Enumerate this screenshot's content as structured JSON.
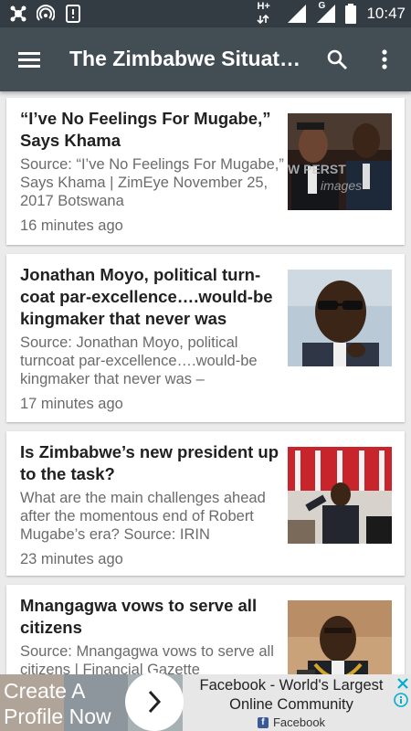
{
  "status_bar": {
    "time": "10:47",
    "network_label": "H+",
    "signal2_label": "G",
    "left_icons": [
      "bug-icon",
      "wifi-hotspot-icon",
      "phone-alert-icon"
    ],
    "right_icons": [
      "signal-icon",
      "battery-icon"
    ]
  },
  "app_bar": {
    "title": "The Zimbabwe Situat…",
    "icons": [
      "menu-icon",
      "search-icon",
      "more-vert-icon"
    ]
  },
  "articles": [
    {
      "title": "“I’ve No Feelings For Mugabe,” Says Khama",
      "description": "Source: “I’ve No Feelings For Mugabe,” Says Khama | ZimEye November 25, 2017 Botswana",
      "age": "16 minutes ago",
      "image_watermark": "W PERST\nimages"
    },
    {
      "title": "Jonathan Moyo, political turn-coat par-excellence….would-be kingmaker that never was",
      "description": "Source: Jonathan Moyo, political turncoat par-excellence….would-be kingmaker that never was –",
      "age": "17 minutes ago"
    },
    {
      "title": "Is Zimbabwe’s new president up to the task?",
      "description": "What are the main challenges ahead after the momentous end of Robert Mugabe’s era? Source: IRIN",
      "age": "23 minutes ago"
    },
    {
      "title": "Mnangagwa vows to serve all citizens",
      "description": "Source: Mnangagwa vows to serve all citizens | Financial Gazette",
      "age": ""
    }
  ],
  "ad": {
    "cta": "Create A Profile Now",
    "headline": "Facebook - World's Largest Online Community",
    "advertiser": "Facebook",
    "colors": {
      "fb_blue": "#3b5998",
      "info_blue": "#00aecd"
    }
  },
  "colors": {
    "status_bar": "#323c42",
    "app_bar": "#424d54",
    "background": "#ebebeb"
  }
}
